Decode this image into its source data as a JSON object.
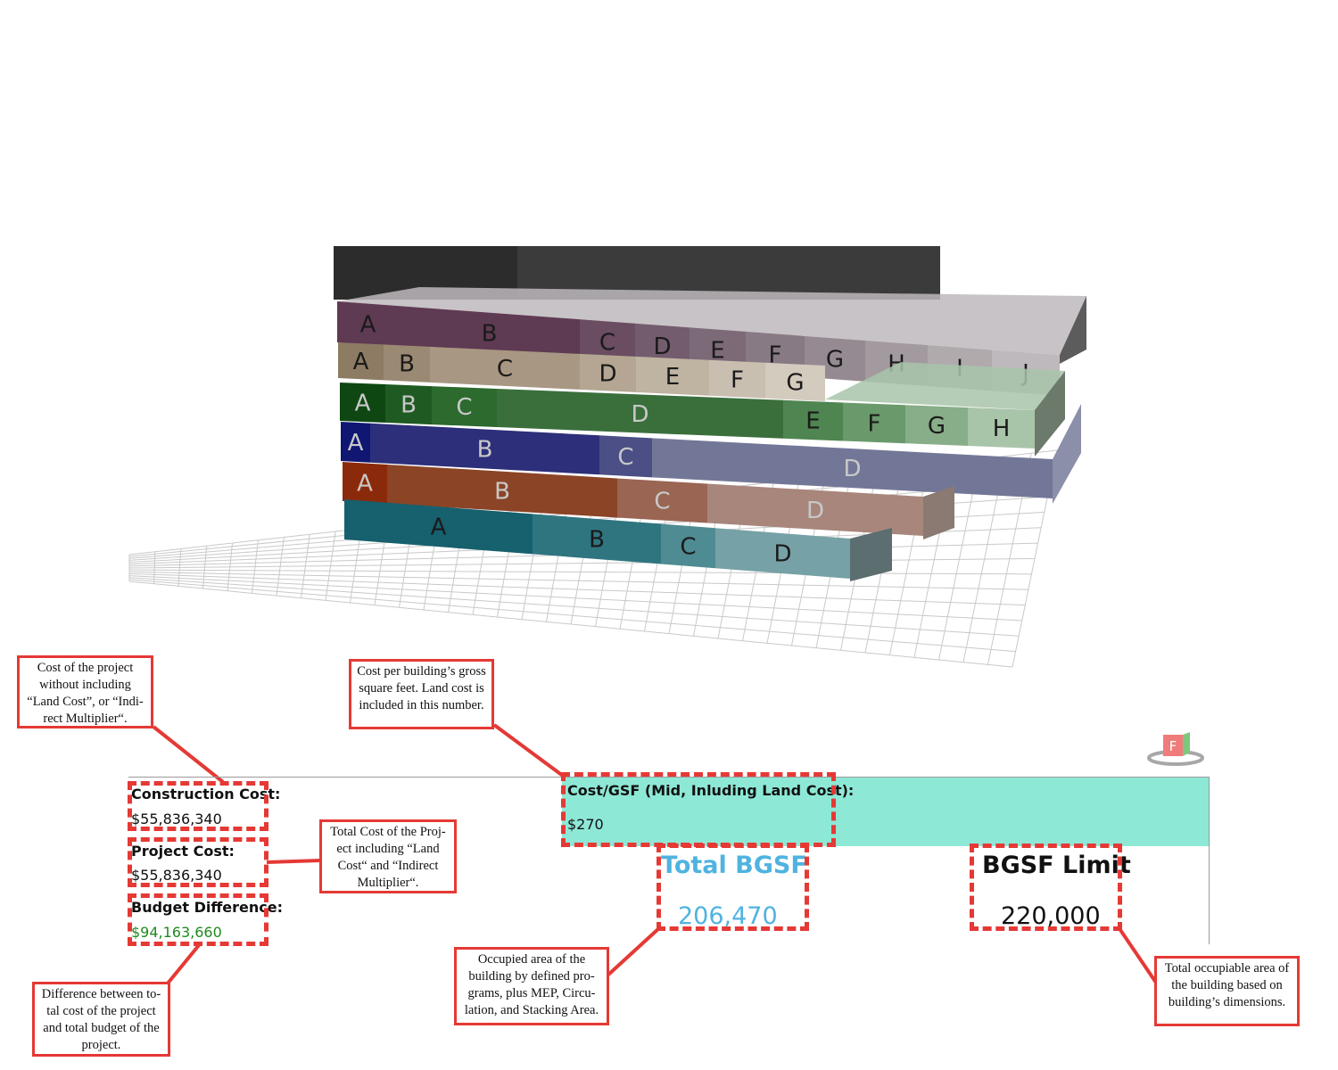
{
  "colors": {
    "annotation": "#e53935",
    "cost_band": "#8ee8d6",
    "total_bgsf": "#4fb3e0",
    "budget_positive": "#1e8a1e"
  },
  "model": {
    "floors": [
      {
        "name": "floor-6",
        "labels": [
          "A",
          "B",
          "C",
          "D",
          "E",
          "F",
          "G",
          "H",
          "I",
          "J"
        ],
        "colors": [
          "#5f3a53",
          "#5f3a53",
          "#6a4d61",
          "#735c6d",
          "#7d6a78",
          "#887a84",
          "#958a92",
          "#a29a9f",
          "#b0aaad",
          "#beb9bc"
        ]
      },
      {
        "name": "floor-5",
        "labels": [
          "A",
          "B",
          "C",
          "D",
          "E",
          "F",
          "G"
        ],
        "colors": [
          "#8d7b64",
          "#9b8a73",
          "#a89883",
          "#b4a692",
          "#bfb3a1",
          "#c9bfb0",
          "#d3cbbe"
        ]
      },
      {
        "name": "floor-4",
        "labels": [
          "A",
          "B",
          "C",
          "D",
          "E",
          "F",
          "G",
          "H"
        ],
        "colors": [
          "#0e4712",
          "#1f5a22",
          "#2c6a2e",
          "#3a6f3c",
          "#4e8550",
          "#6a9a6b",
          "#87ae88",
          "#a8c4a9"
        ]
      },
      {
        "name": "floor-3",
        "labels": [
          "A",
          "B",
          "C",
          "D"
        ],
        "colors": [
          "#0f1773",
          "#2d2f7a",
          "#4b4f86",
          "#737797"
        ]
      },
      {
        "name": "floor-2",
        "labels": [
          "A",
          "B",
          "C",
          "D"
        ],
        "colors": [
          "#8b2a0a",
          "#8b4426",
          "#9a6553",
          "#a8867b"
        ]
      },
      {
        "name": "floor-1",
        "labels": [
          "A",
          "B",
          "C",
          "D"
        ],
        "colors": [
          "#17606e",
          "#2f7580",
          "#4f8b92",
          "#76a1a6"
        ]
      }
    ]
  },
  "annotations": {
    "construction": "Cost of the project without including “Land Cost”, or “Indi-rect Multiplier“.",
    "cost_gsf": "Cost per building’s gross square feet. Land cost is included in this number.",
    "project": "Total Cost of the Proj-ect including “Land Cost“ and “Indirect Multiplier“.",
    "budget": "Difference between to-tal cost of the project and total budget of the project.",
    "total_bgsf": "Occupied area of the building by defined pro-grams, plus MEP, Circu-lation, and Stacking Area.",
    "bgsf_limit": "Total occupiable area of the building based on building’s dimensions."
  },
  "metrics": {
    "construction_cost": {
      "label": "Construction Cost:",
      "value": "$55,836,340"
    },
    "project_cost": {
      "label": "Project Cost:",
      "value": "$55,836,340"
    },
    "budget_difference": {
      "label": "Budget Difference:",
      "value": "$94,163,660"
    },
    "cost_per_gsf": {
      "label": "Cost/GSF (Mid, Inluding Land Cost):",
      "value": "$270"
    },
    "total_bgsf": {
      "label": "Total BGSF",
      "value": "206,470"
    },
    "bgsf_limit": {
      "label": "BGSF Limit",
      "value": "220,000"
    }
  },
  "icons": {
    "view_toggle": "f-cube-icon"
  }
}
